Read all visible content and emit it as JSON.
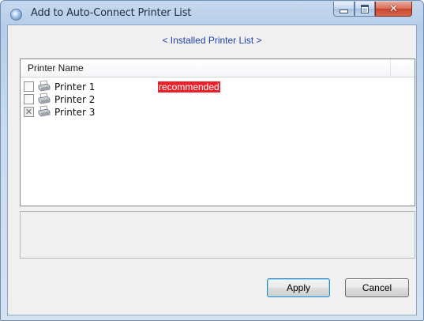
{
  "window": {
    "title": "Add to Auto-Connect Printer List",
    "controls": {
      "minimize": "minimize",
      "maximize": "maximize",
      "close": "✕"
    }
  },
  "list_heading": "< Installed Printer List >",
  "table": {
    "columns": [
      "Printer Name"
    ],
    "rows": [
      {
        "name": "Printer 1",
        "checked": false,
        "badge": "recommended"
      },
      {
        "name": "Printer 2",
        "checked": false,
        "badge": ""
      },
      {
        "name": "Printer 3",
        "checked": true,
        "badge": ""
      }
    ]
  },
  "buttons": {
    "apply": "Apply",
    "cancel": "Cancel"
  },
  "colors": {
    "badge_bg": "#e8212b",
    "heading_text": "#1f3fae"
  },
  "icons": {
    "app": "app-icon",
    "printer": "printer-icon"
  }
}
